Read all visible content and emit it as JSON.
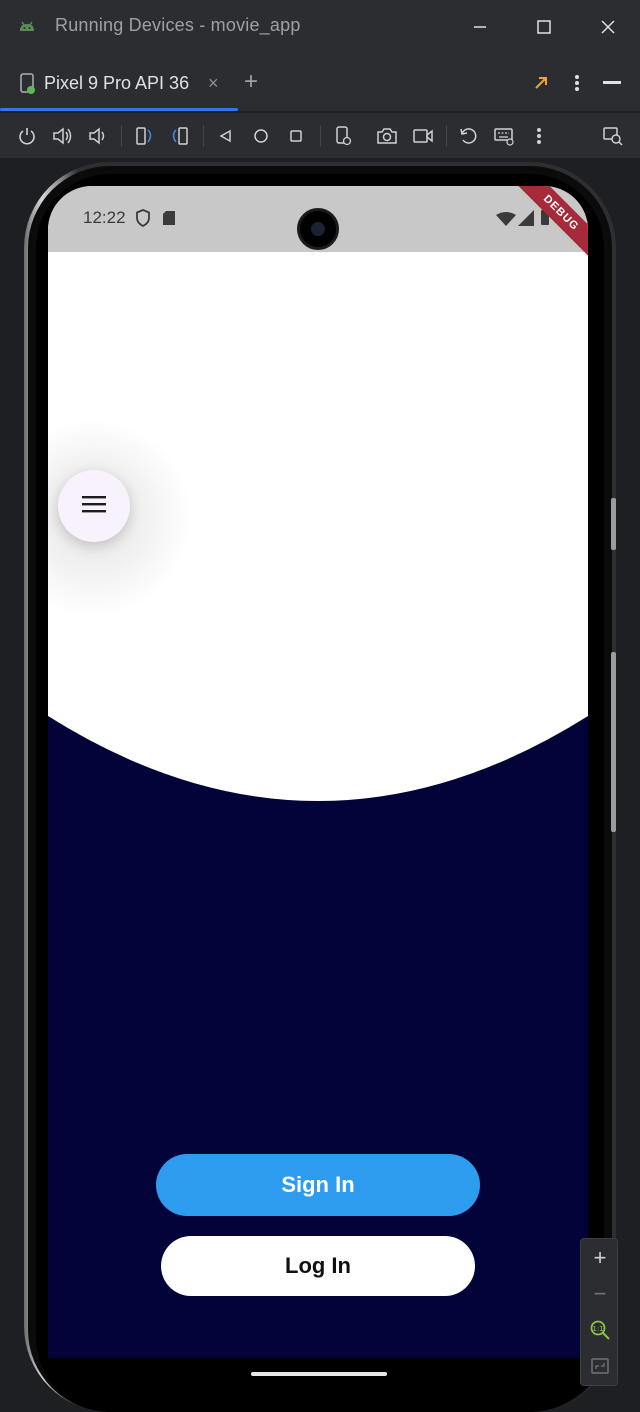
{
  "window": {
    "title": "Running Devices - movie_app",
    "icons": [
      "android-icon",
      "minimize-icon",
      "maximize-icon",
      "close-icon"
    ]
  },
  "tabs": [
    {
      "label": "Pixel 9 Pro API 36",
      "close": "×",
      "active": true
    }
  ],
  "tabbar": {
    "add": "+"
  },
  "toolbar": {
    "icons": [
      "power-icon",
      "volume-up-icon",
      "volume-down-icon",
      "rotate-left-icon",
      "rotate-right-icon",
      "back-icon",
      "home-icon",
      "overview-icon",
      "device-settings-icon",
      "screenshot-icon",
      "screen-record-icon",
      "restore-icon",
      "keyboard-icon",
      "more-icon",
      "device-mirror-icon"
    ]
  },
  "device": {
    "status_time": "12:22",
    "debug_banner": "DEBUG"
  },
  "app": {
    "signin_label": "Sign In",
    "login_label": "Log In"
  },
  "zoom": {
    "in": "+",
    "out": "−"
  },
  "colors": {
    "background_dark": "#020339",
    "signin_blue": "#2d9cee",
    "tab_accent": "#3574f0",
    "debug_red": "#a52a3a"
  }
}
